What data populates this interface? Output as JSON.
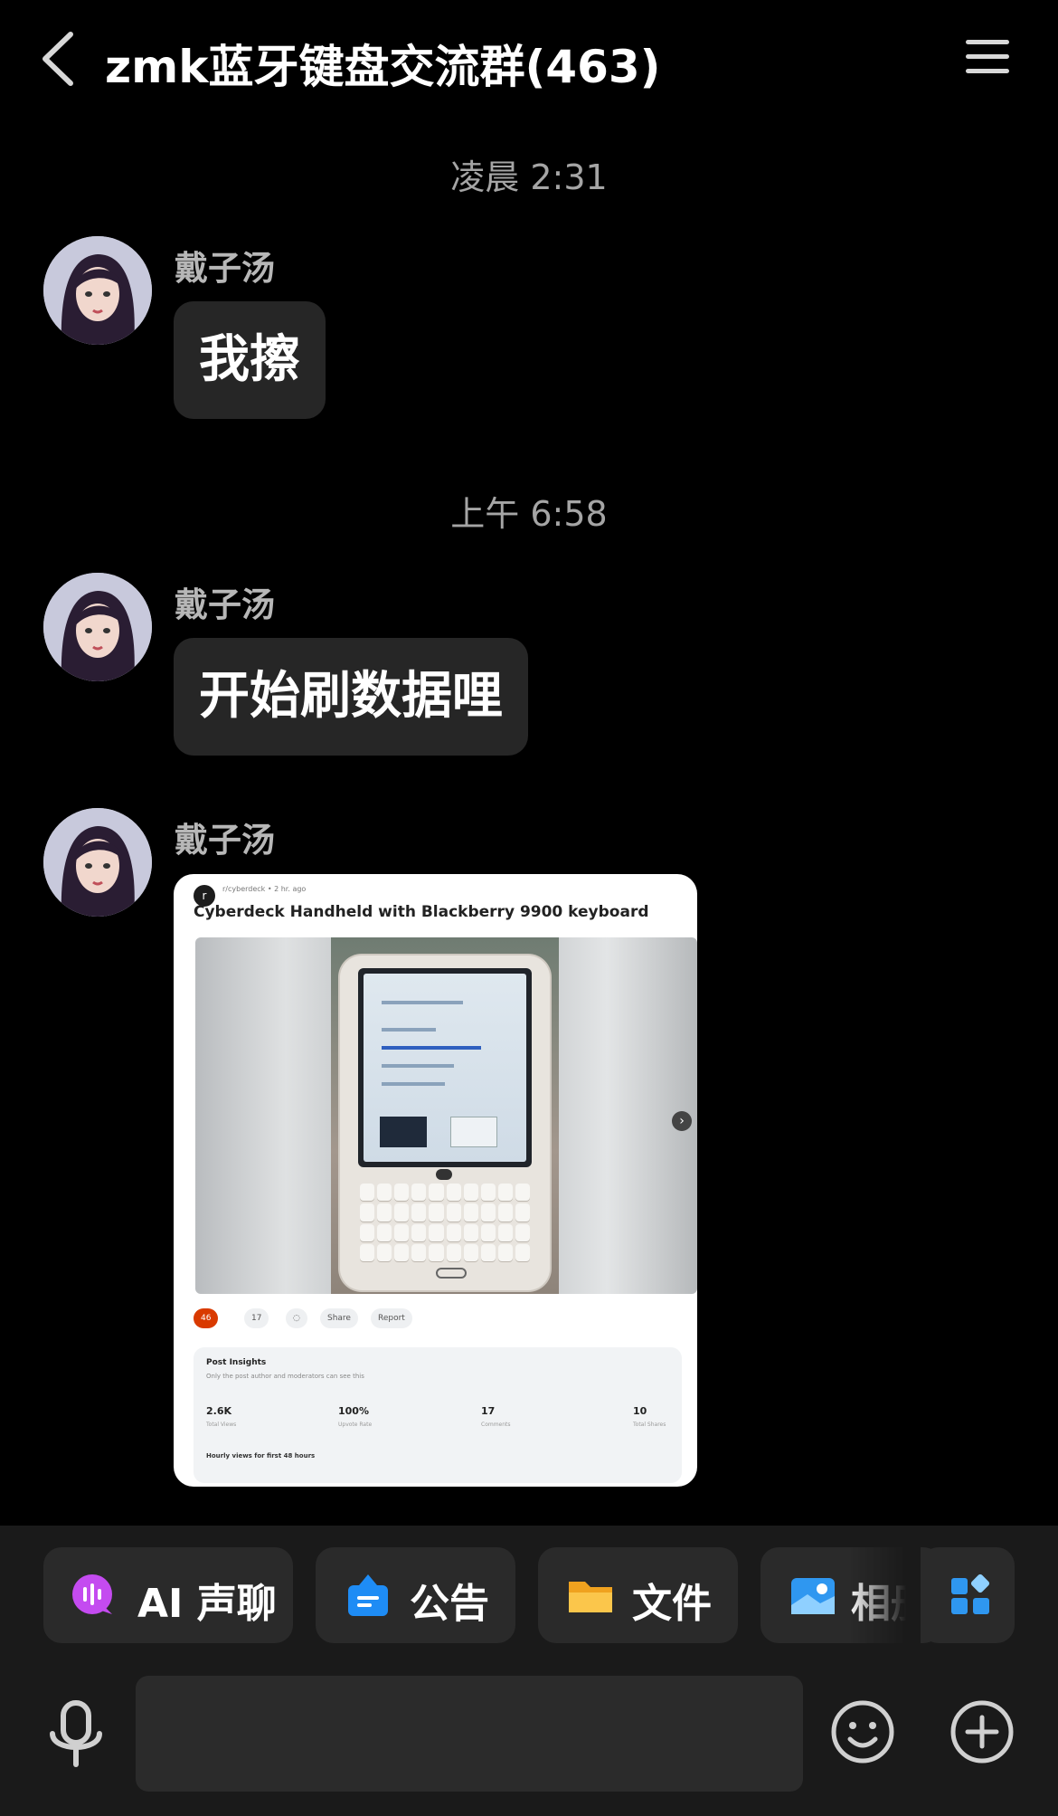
{
  "header": {
    "title": "zmk蓝牙键盘交流群(463)",
    "back_icon": "chevron-left-icon",
    "menu_icon": "hamburger-menu-icon"
  },
  "messages": [
    {
      "time": "凌晨 2:31",
      "sender": "戴子汤",
      "text": "我擦"
    },
    {
      "time": "上午 6:58",
      "sender": "戴子汤",
      "text": "开始刷数据哩"
    },
    {
      "sender": "戴子汤",
      "type": "image"
    }
  ],
  "image_post": {
    "meta": "r/cyberdeck • 2 hr. ago",
    "title": "Cyberdeck Handheld with Blackberry 9900 keyboard",
    "actions": [
      "46",
      "17",
      "",
      "Share",
      "Report"
    ],
    "insights": {
      "title": "Post Insights",
      "subtitle": "Only the post author and moderators can see this",
      "stats": [
        {
          "value": "2.6K",
          "label": "Total Views"
        },
        {
          "value": "100%",
          "label": "Upvote Rate"
        },
        {
          "value": "17",
          "label": "Comments"
        },
        {
          "value": "10",
          "label": "Total Shares"
        }
      ],
      "hourly": "Hourly views for first 48 hours"
    }
  },
  "toolbar": {
    "chips": [
      {
        "label": "AI 声聊",
        "icon": "ai-voice-chat-icon",
        "color": "#c44bf0"
      },
      {
        "label": "公告",
        "icon": "announcement-icon",
        "color": "#1e8cf5"
      },
      {
        "label": "文件",
        "icon": "folder-icon",
        "color": "#f7b733"
      },
      {
        "label": "相册",
        "icon": "photo-album-icon",
        "color": "#2f97f0"
      }
    ],
    "apps_icon": "apps-grid-icon",
    "input_placeholder": "",
    "mic_icon": "microphone-icon",
    "emoji_icon": "emoji-icon",
    "plus_icon": "plus-circle-icon"
  }
}
